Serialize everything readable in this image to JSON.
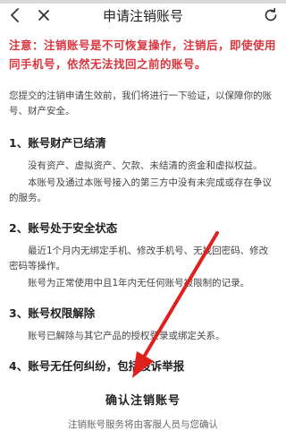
{
  "nav": {
    "title": "申请注销账号",
    "icons": [
      "back-icon",
      "close-icon",
      "refresh-icon"
    ]
  },
  "warning": "注意：注销账号是不可恢复操作，注销后，即使使用同手机号，依然无法找回之前的账号。",
  "intro": "您提交的注销申请生效前，我们将进行一下验证，以保障你的账号、财产安全。",
  "sections": [
    {
      "title": "1、账号财产已结清",
      "paragraphs": [
        "没有资产、虚拟资产、欠款、未结清的资金和虚拟权益。",
        "本账号及通过本账号接入的第三方中没有未完成或存在争议的服务。"
      ]
    },
    {
      "title": "2、账号处于安全状态",
      "paragraphs": [
        "最近1个月内无绑定手机、修改手机号、无找回密码、修改密码等操作。",
        "账号为正常使用中且1年内无任何账号被限制的记录。"
      ]
    },
    {
      "title": "3、账号权限解除",
      "paragraphs": [
        "账号已解除与其它产品的授权登录或绑定关系。"
      ]
    },
    {
      "title": "4、账号无任何纠纷，包括投诉举报",
      "paragraphs": []
    }
  ],
  "confirm_label": "确认注销账号",
  "footer_note": "注销账号服务将由客服人员与您确认",
  "colors": {
    "warning": "#d9363e",
    "annotation_arrow": "#e0201b"
  }
}
